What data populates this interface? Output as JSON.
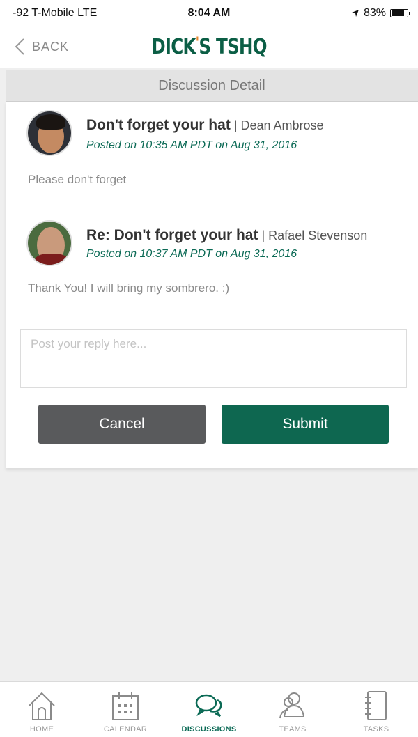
{
  "status_bar": {
    "carrier": "-92 T-Mobile  LTE",
    "time": "8:04 AM",
    "battery": "83%",
    "battery_level": 0.83
  },
  "header": {
    "back_label": "BACK",
    "logo_text_left": "DICK",
    "logo_apostrophe": "'",
    "logo_text_right": "S TSHQ",
    "brand_color": "#0b5e45"
  },
  "page_title": "Discussion Detail",
  "posts": [
    {
      "subject": "Don't forget your hat",
      "separator": " | ",
      "author": "Dean Ambrose",
      "date": "Posted on 10:35 AM PDT on Aug 31, 2016",
      "body": "Please don't forget"
    },
    {
      "subject": "Re: Don't forget your hat",
      "separator": " | ",
      "author": "Rafael Stevenson",
      "date": "Posted on 10:37 AM PDT on Aug 31, 2016",
      "body": "Thank You! I will bring my sombrero. :)"
    }
  ],
  "reply": {
    "placeholder": "Post your reply here...",
    "value": ""
  },
  "buttons": {
    "cancel": "Cancel",
    "submit": "Submit"
  },
  "tabs": [
    {
      "label": "HOME",
      "icon": "home-icon"
    },
    {
      "label": "CALENDAR",
      "icon": "calendar-icon"
    },
    {
      "label": "DISCUSSIONS",
      "icon": "discussions-icon",
      "active": true
    },
    {
      "label": "TEAMS",
      "icon": "teams-icon"
    },
    {
      "label": "TASKS",
      "icon": "tasks-icon"
    }
  ],
  "colors": {
    "accent": "#0e6750",
    "cancel": "#595a5c",
    "date_text": "#0b6a55"
  }
}
